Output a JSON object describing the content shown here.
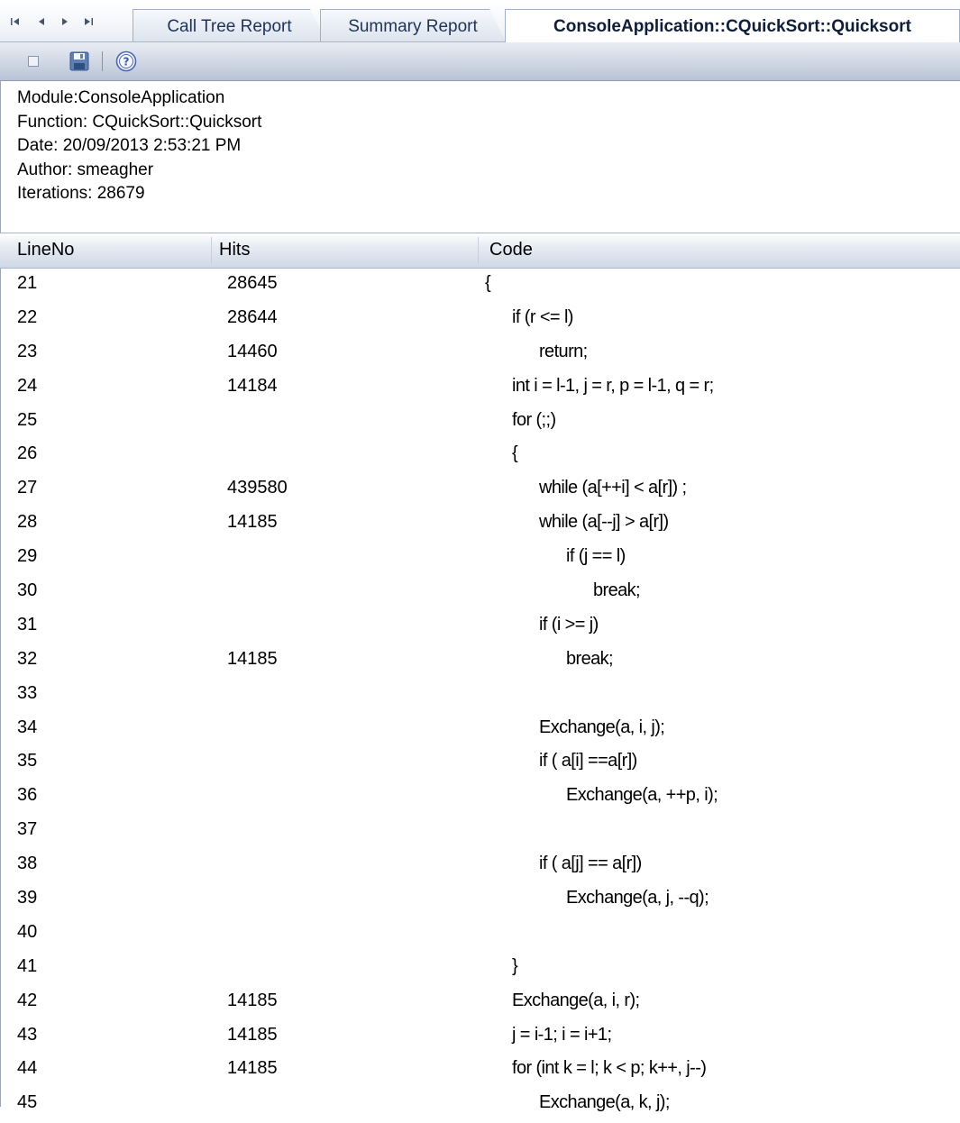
{
  "tabs": [
    {
      "label": "Call Tree Report",
      "active": false
    },
    {
      "label": "Summary Report",
      "active": false
    },
    {
      "label": "ConsoleApplication::CQuickSort::Quicksort",
      "active": true
    }
  ],
  "nav_icons": [
    "first-icon",
    "previous-icon",
    "next-icon",
    "last-icon"
  ],
  "toolbar": {
    "icons": [
      "stop-icon",
      "save-icon",
      "help-icon"
    ]
  },
  "info": {
    "module": "Module:ConsoleApplication",
    "function": "Function: CQuickSort::Quicksort",
    "date": "Date: 20/09/2013 2:53:21 PM",
    "author": "Author: smeagher",
    "iterations": "Iterations: 28679"
  },
  "table": {
    "columns": [
      "LineNo",
      "Hits",
      "Code"
    ],
    "rows": [
      {
        "line": "21",
        "hits": "28645",
        "indent": 0,
        "code": "{"
      },
      {
        "line": "22",
        "hits": "28644",
        "indent": 1,
        "code": "if (r <= l)"
      },
      {
        "line": "23",
        "hits": "14460",
        "indent": 2,
        "code": "return;"
      },
      {
        "line": "24",
        "hits": "14184",
        "indent": 1,
        "code": "int i = l-1, j = r, p = l-1, q = r;"
      },
      {
        "line": "25",
        "hits": "",
        "indent": 1,
        "code": "for (;;)"
      },
      {
        "line": "26",
        "hits": "",
        "indent": 1,
        "code": "{"
      },
      {
        "line": "27",
        "hits": "439580",
        "indent": 2,
        "code": "while (a[++i] < a[r]) ;"
      },
      {
        "line": "28",
        "hits": "14185",
        "indent": 2,
        "code": "while (a[--j] > a[r])"
      },
      {
        "line": "29",
        "hits": "",
        "indent": 3,
        "code": "if (j == l)"
      },
      {
        "line": "30",
        "hits": "",
        "indent": 4,
        "code": "break;"
      },
      {
        "line": "31",
        "hits": "",
        "indent": 2,
        "code": "if (i >= j)"
      },
      {
        "line": "32",
        "hits": "14185",
        "indent": 3,
        "code": "break;"
      },
      {
        "line": "33",
        "hits": "",
        "indent": 0,
        "code": ""
      },
      {
        "line": "34",
        "hits": "",
        "indent": 2,
        "code": "Exchange(a, i, j);"
      },
      {
        "line": "35",
        "hits": "",
        "indent": 2,
        "code": "if ( a[i] ==a[r])"
      },
      {
        "line": "36",
        "hits": "",
        "indent": 3,
        "code": "Exchange(a, ++p, i);"
      },
      {
        "line": "37",
        "hits": "",
        "indent": 0,
        "code": ""
      },
      {
        "line": "38",
        "hits": "",
        "indent": 2,
        "code": "if ( a[j] == a[r])"
      },
      {
        "line": "39",
        "hits": "",
        "indent": 3,
        "code": "Exchange(a, j, --q);"
      },
      {
        "line": "40",
        "hits": "",
        "indent": 0,
        "code": ""
      },
      {
        "line": "41",
        "hits": "",
        "indent": 1,
        "code": "}"
      },
      {
        "line": "42",
        "hits": "14185",
        "indent": 1,
        "code": "Exchange(a, i, r);"
      },
      {
        "line": "43",
        "hits": "14185",
        "indent": 1,
        "code": "j = i-1; i = i+1;"
      },
      {
        "line": "44",
        "hits": "14185",
        "indent": 1,
        "code": "for (int k = l; k < p; k++, j--)"
      },
      {
        "line": "45",
        "hits": "",
        "indent": 2,
        "code": "Exchange(a, k, j);"
      }
    ]
  }
}
